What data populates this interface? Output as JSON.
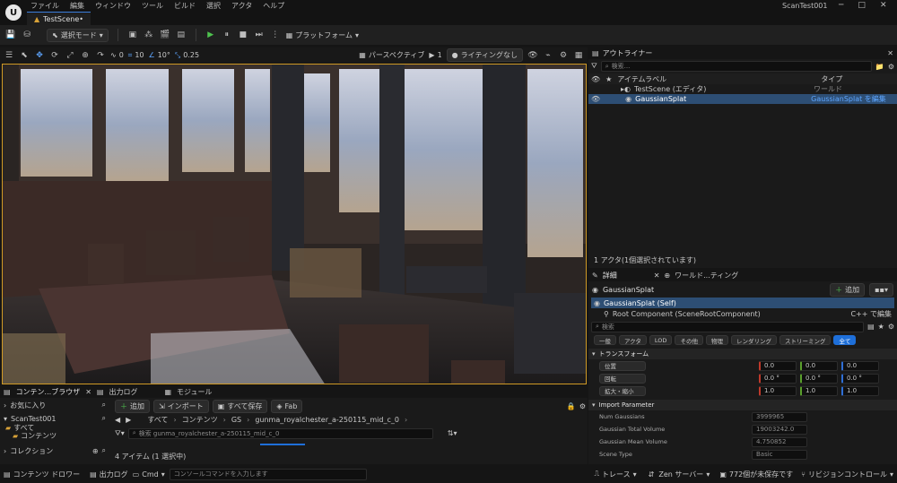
{
  "menu": {
    "items": [
      "ファイル",
      "編集",
      "ウィンドウ",
      "ツール",
      "ビルド",
      "選択",
      "アクタ",
      "ヘルプ"
    ],
    "project": "ScanTest001"
  },
  "tab": {
    "label": "TestScene•"
  },
  "toolbar": {
    "mode": "選択モード",
    "platform": "プラットフォーム"
  },
  "viewport": {
    "perspective": "パースペクティブ",
    "lighting": "ライティングなし",
    "grid_snap": "10",
    "rot_snap": "10°",
    "scale_snap": "0.25",
    "angle_a": "0",
    "cam_count": "1"
  },
  "outliner": {
    "title": "アウトライナー",
    "search_placeholder": "検索...",
    "col_label": "アイテムラベル",
    "col_type": "タイプ",
    "rows": [
      {
        "label": "TestScene (エディタ)",
        "type": "ワールド"
      },
      {
        "label": "GaussianSplat",
        "type": "GaussianSplat を編集"
      }
    ],
    "status": "1 アクタ(1個選択されています)"
  },
  "details": {
    "tab_details": "詳細",
    "tab_world": "ワールド...ティング",
    "actor": "GaussianSplat",
    "add": "追加",
    "self": "GaussianSplat (Self)",
    "root": "Root Component (SceneRootComponent)",
    "cpp": "C++ で編集",
    "search_placeholder": "検索",
    "filters": [
      "一般",
      "アクタ",
      "LOD",
      "その他",
      "物理",
      "レンダリング",
      "ストリーミング",
      "全て"
    ],
    "transform_section": "トランスフォーム",
    "transform": [
      {
        "label": "位置",
        "x": "0.0",
        "y": "0.0",
        "z": "0.0"
      },
      {
        "label": "回転",
        "x": "0.0 °",
        "y": "0.0 °",
        "z": "0.0 °"
      },
      {
        "label": "拡大・縮小",
        "x": "1.0",
        "y": "1.0",
        "z": "1.0"
      }
    ],
    "import_section": "Import Parameter",
    "params": [
      {
        "label": "Num Gaussians",
        "value": "3999965"
      },
      {
        "label": "Gaussian Total Volume",
        "value": "19003242.0"
      },
      {
        "label": "Gaussian Mean Volume",
        "value": "4.750852"
      },
      {
        "label": "Scene Type",
        "value": "Basic"
      }
    ]
  },
  "content": {
    "tab_browser": "コンテン...ブラウザ",
    "tab_output": "出力ログ",
    "tab_module": "モジュール",
    "favorites": "お気に入り",
    "project": "ScanTest001",
    "tree_all": "すべて",
    "tree_content": "コンテンツ",
    "collections": "コレクション",
    "add": "追加",
    "import": "インポート",
    "save_all": "すべて保存",
    "fab": "Fab",
    "path": [
      "すべて",
      "コンテンツ",
      "GS",
      "gunma_royalchester_a-250115_mid_c_0"
    ],
    "search_placeholder": "検索 gunma_royalchester_a-250115_mid_c_0",
    "count": "4 アイテム (1 選択中)"
  },
  "status_bar": {
    "drawer": "コンテンツ ドロワー",
    "output": "出力ログ",
    "cmd": "Cmd",
    "cmd_placeholder": "コンソールコマンドを入力します",
    "trace": "トレース",
    "zen": "Zen サーバー",
    "unsaved": "772個が未保存です",
    "revision": "リビジョンコントロール"
  }
}
